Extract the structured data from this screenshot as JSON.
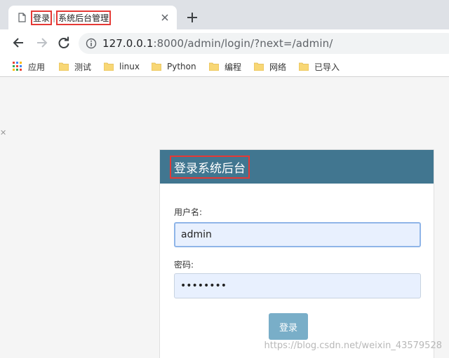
{
  "browser": {
    "tab": {
      "title_part1": "登录",
      "separator": "|",
      "title_part2": "系统后台管理"
    },
    "address": {
      "host": "127.0.0.1",
      "path": ":8000/admin/login/?next=/admin/"
    },
    "bookmarks": [
      "应用",
      "测试",
      "linux",
      "Python",
      "编程",
      "网络",
      "已导入"
    ]
  },
  "login": {
    "title": "登录系统后台",
    "username_label": "用户名:",
    "username_value": "admin",
    "password_label": "密码:",
    "password_value": "••••••••",
    "submit_label": "登录"
  },
  "watermark": "https://blog.csdn.net/weixin_43579528",
  "colors": {
    "header": "#417690",
    "button": "#79aec8",
    "highlight": "#e53935",
    "field_bg": "#e8f0fe"
  }
}
